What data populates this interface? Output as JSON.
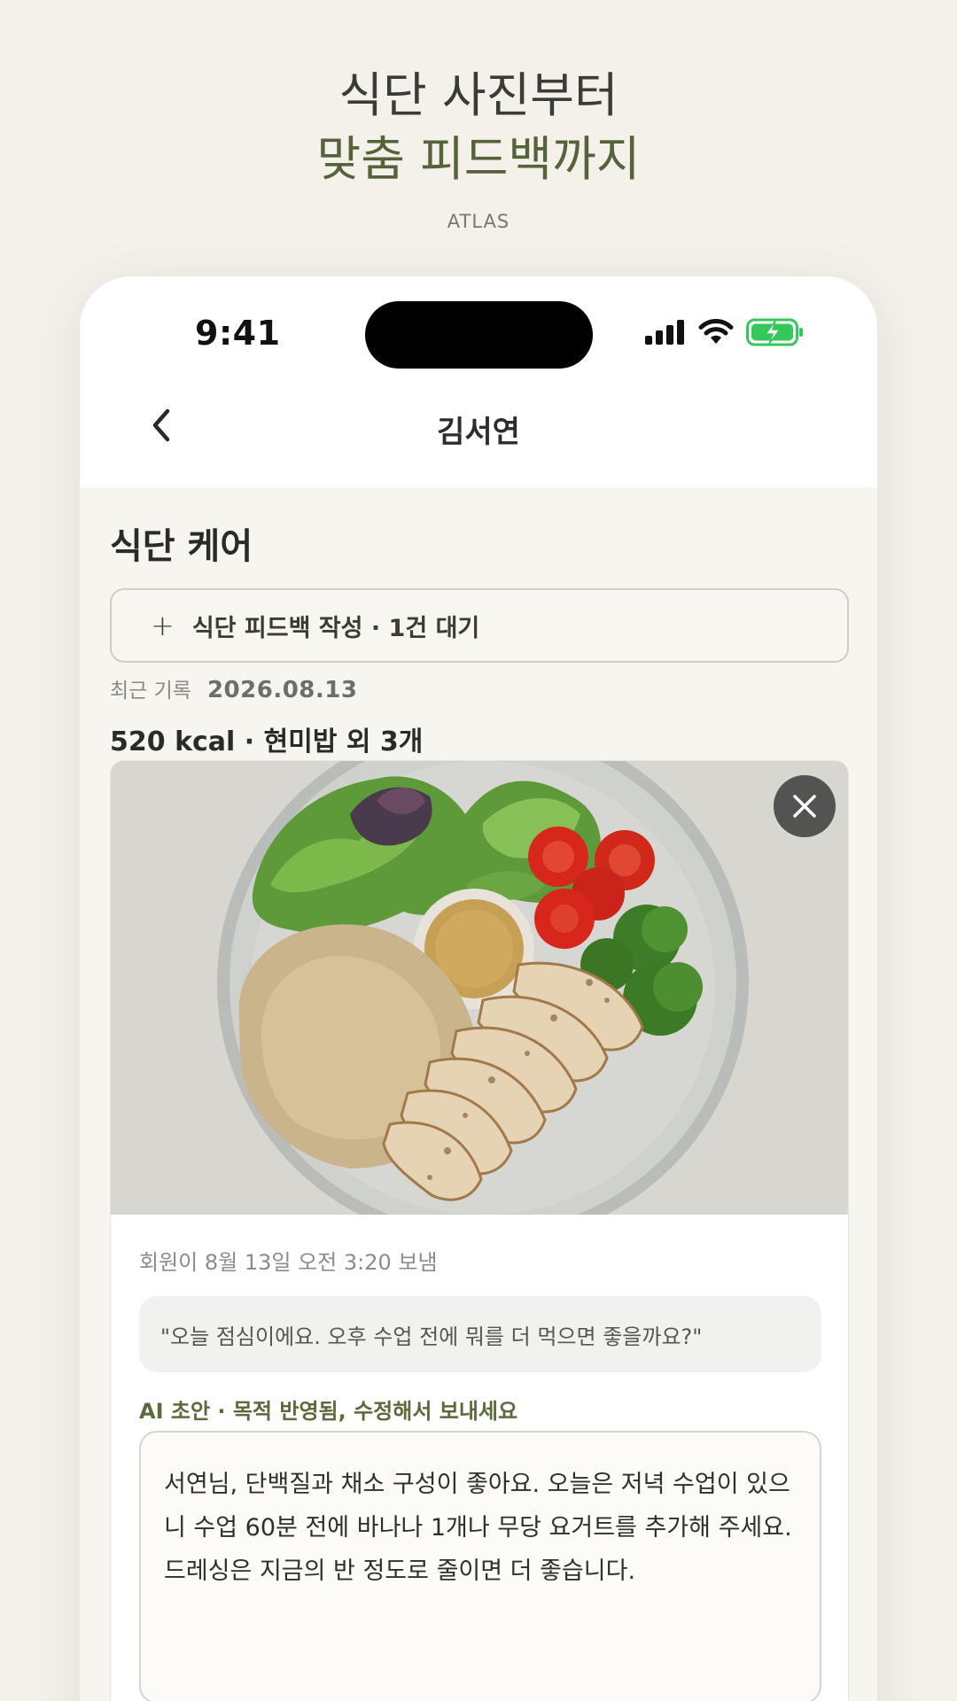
{
  "hero": {
    "line1": "식단 사진부터",
    "line2": "맞춤 피드백까지",
    "brand": "ATLAS"
  },
  "status_bar": {
    "time": "9:41",
    "icons": [
      "cellular-signal-icon",
      "wifi-icon",
      "battery-charging-icon"
    ]
  },
  "nav": {
    "back_icon": "chevron-left-icon",
    "title": "김서연"
  },
  "section": {
    "title": "식단 케어"
  },
  "add_feedback": {
    "icon": "plus-icon",
    "label": "식단 피드백 작성 · 1건 대기"
  },
  "recent": {
    "label": "최근 기록",
    "date": "2026.08.13"
  },
  "meal": {
    "summary": "520 kcal · 현미밥 외 3개"
  },
  "card": {
    "photo_alt": "meal photo: brown rice, grilled chicken breast, salad greens, cherry tomatoes, broccoli, dressing",
    "close_icon": "close-icon",
    "sent_meta": "회원이 8월 13일 오전 3:20 보냄",
    "member_message": "\"오늘 점심이에요. 오후 수업 전에 뭐를 더 먹으면 좋을까요?\"",
    "ai_label": "AI 초안 · 목적 반영됨, 수정해서 보내세요",
    "draft_text": "서연님, 단백질과 채소 구성이 좋아요. 오늘은 저녁 수업이 있으니 수업 60분 전에 바나나 1개나 무당 요거트를 추가해 주세요. 드레싱은 지금의 반 정도로 줄이면 더 좋습니다."
  },
  "colors": {
    "background": "#f3f1ea",
    "accent_olive": "#5b6a3a",
    "battery_green": "#34c759"
  }
}
